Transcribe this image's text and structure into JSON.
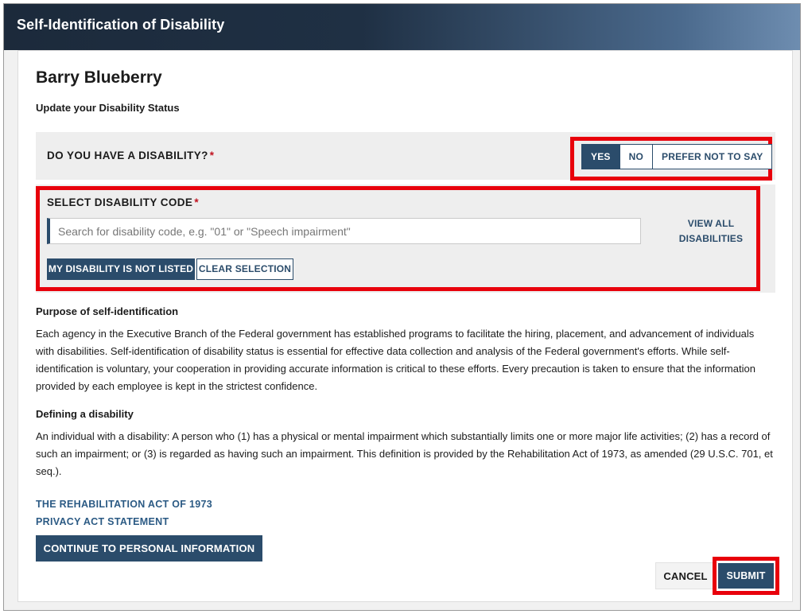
{
  "header": {
    "title": "Self-Identification of Disability"
  },
  "profile": {
    "name": "Barry Blueberry",
    "subtitle": "Update your Disability Status"
  },
  "question": {
    "label": "DO YOU HAVE A DISABILITY?",
    "required_mark": "*",
    "options": [
      "YES",
      "NO",
      "PREFER NOT TO SAY"
    ],
    "selected": "YES"
  },
  "code": {
    "label": "SELECT DISABILITY CODE",
    "required_mark": "*",
    "search_placeholder": "Search for disability code, e.g. \"01\" or \"Speech impairment\"",
    "view_all_line1": "VIEW ALL",
    "view_all_line2": "DISABILITIES",
    "not_listed_label": "MY DISABILITY IS NOT LISTED",
    "clear_label": "CLEAR SELECTION"
  },
  "purpose": {
    "heading": "Purpose of self-identification",
    "text": "Each agency in the Executive Branch of the Federal government has established programs to facilitate the hiring, placement, and advancement of individuals with disabilities. Self-identification of disability status is essential for effective data collection and analysis of the Federal government's efforts. While self-identification is voluntary, your cooperation in providing accurate information is critical to these efforts. Every precaution is taken to ensure that the information provided by each employee is kept in the strictest confidence."
  },
  "definition": {
    "heading": "Defining a disability",
    "text": "An individual with a disability: A person who (1) has a physical or mental impairment which substantially limits one or more major life activities; (2) has a record of such an impairment; or (3) is regarded as having such an impairment. This definition is provided by the Rehabilitation Act of 1973, as amended (29 U.S.C. 701, et seq.)."
  },
  "links": {
    "rehab_act": "THE REHABILITATION ACT OF 1973",
    "privacy": "PRIVACY ACT STATEMENT"
  },
  "actions": {
    "continue": "CONTINUE TO PERSONAL INFORMATION",
    "cancel": "CANCEL",
    "submit": "SUBMIT"
  },
  "colors": {
    "primary": "#2b4c6b",
    "highlight": "#e8000b",
    "required": "#c0121f"
  }
}
